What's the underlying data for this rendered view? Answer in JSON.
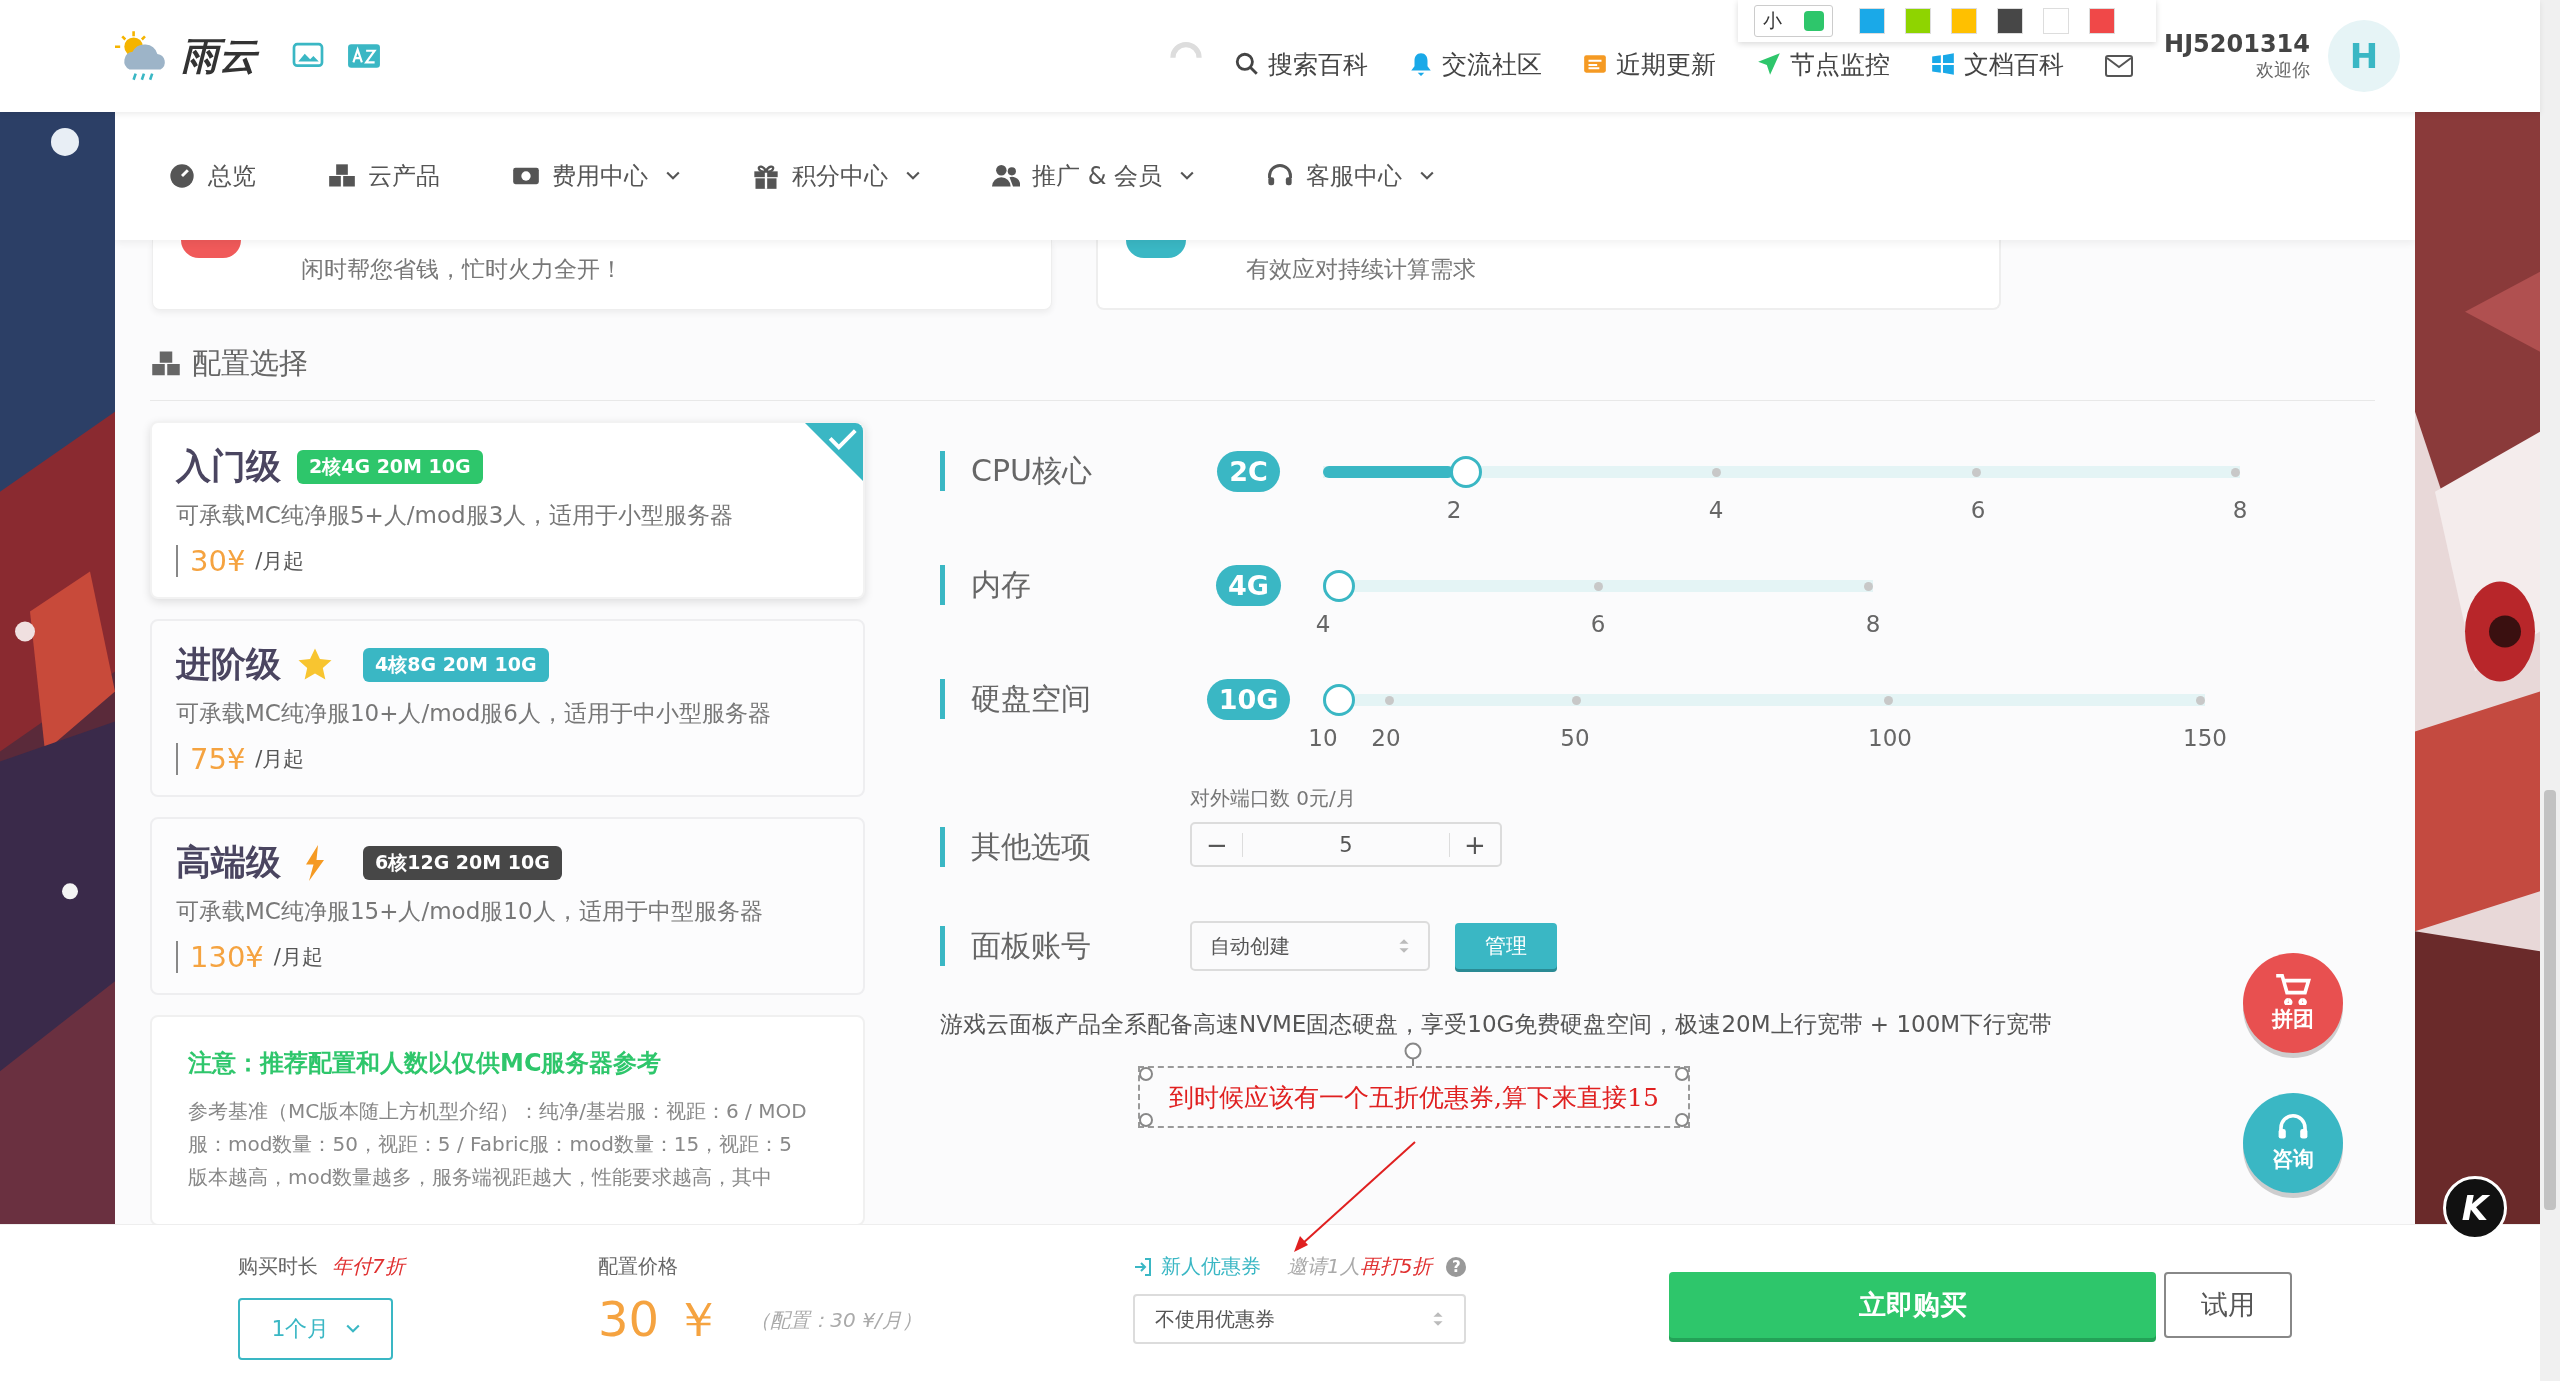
{
  "header": {
    "logo": "雨云",
    "links": [
      {
        "label": "搜索百科"
      },
      {
        "label": "交流社区"
      },
      {
        "label": "近期更新"
      },
      {
        "label": "节点监控"
      },
      {
        "label": "文档百科"
      }
    ],
    "user": {
      "name": "HJ5201314",
      "greeting": "欢迎你",
      "avatar": "H"
    }
  },
  "palette": {
    "size": "小",
    "swatches": [
      {
        "color": "#1aa9e8"
      },
      {
        "color": "#8fd400"
      },
      {
        "color": "#ffc000"
      },
      {
        "color": "#474747"
      },
      {
        "color": "#ffffff"
      },
      {
        "color": "#f04848"
      }
    ]
  },
  "nav": [
    {
      "label": "总览",
      "dropdown": false
    },
    {
      "label": "云产品",
      "dropdown": false
    },
    {
      "label": "费用中心",
      "dropdown": true
    },
    {
      "label": "积分中心",
      "dropdown": true
    },
    {
      "label": "推广 & 会员",
      "dropdown": true
    },
    {
      "label": "客服中心",
      "dropdown": true
    }
  ],
  "promo_cards": [
    {
      "text": "闲时帮您省钱，忙时火力全开！",
      "color": "#f05a5a"
    },
    {
      "text": "有效应对持续计算需求",
      "color": "#3ab7c4"
    }
  ],
  "section_title": "配置选择",
  "plans": [
    {
      "name": "入门级",
      "kind": "plain",
      "badge": "2核4G 20M 10G",
      "color": "#2ec66b",
      "desc": "可承载MC纯净服5+人/mod服3人，适用于小型服务器",
      "price": "30¥",
      "unit": "/月起",
      "selected": true
    },
    {
      "name": "进阶级",
      "kind": "star",
      "badge": "4核8G 20M 10G",
      "color": "#3ab7c4",
      "desc": "可承载MC纯净服10+人/mod服6人，适用于中小型服务器",
      "price": "75¥",
      "unit": "/月起",
      "selected": false
    },
    {
      "name": "高端级",
      "kind": "bolt",
      "badge": "6核12G 20M 10G",
      "color": "#474747",
      "desc": "可承载MC纯净服15+人/mod服10人，适用于中型服务器",
      "price": "130¥",
      "unit": "/月起",
      "selected": false
    }
  ],
  "note": {
    "title": "注意：推荐配置和人数以仅供MC服务器参考",
    "body": "参考基准（MC版本随上方机型介绍）：纯净/基岩服：视距：6 / MOD服：mod数量：50，视距：5 / Fabric服：mod数量：15，视距：5\n版本越高，mod数量越多，服务端视距越大，性能要求越高，其中"
  },
  "options": [
    {
      "kind": "slider",
      "label": "CPU核心",
      "value": "2C",
      "level": 0.143,
      "ticks": [
        "2",
        "4",
        "6",
        "8"
      ]
    },
    {
      "kind": "slider",
      "label": "内存",
      "value": "4G",
      "level": 0,
      "ticks": [
        "4",
        "6",
        "8"
      ]
    },
    {
      "kind": "slider",
      "label": "硬盘空间",
      "value": "10G",
      "level": 0,
      "ticks": [
        "10",
        "20",
        "50",
        "100",
        "150"
      ]
    },
    {
      "kind": "stepper",
      "label": "其他选项",
      "caption": "对外端口数 0元/月",
      "minus": "−",
      "value": "5",
      "plus": "+"
    },
    {
      "kind": "select",
      "label": "面板账号",
      "value": "自动创建",
      "button": "管理"
    }
  ],
  "description": "游戏云面板产品全系配备高速NVME固态硬盘，享受10G免费硬盘空间，极速20M上行宽带 + 100M下行宽带",
  "annotation": "到时候应该有一个五折优惠券,算下来直接15",
  "floating": [
    {
      "kind": "group",
      "label": "拼团"
    },
    {
      "kind": "consult",
      "label": "咨询"
    }
  ],
  "corner_badge": "K",
  "footer": {
    "duration_label": "购买时长",
    "duration_discount": "年付7折",
    "duration": "1个月",
    "price_label": "配置价格",
    "price": "30 ￥",
    "price_detail": "（配置：30 ¥/月）",
    "coupon_link": "新人优惠券",
    "invite": "邀请1人",
    "invite_discount": "再打5折",
    "help": "?",
    "coupon": "不使用优惠券",
    "buy": "立即购买",
    "trial": "试用"
  }
}
